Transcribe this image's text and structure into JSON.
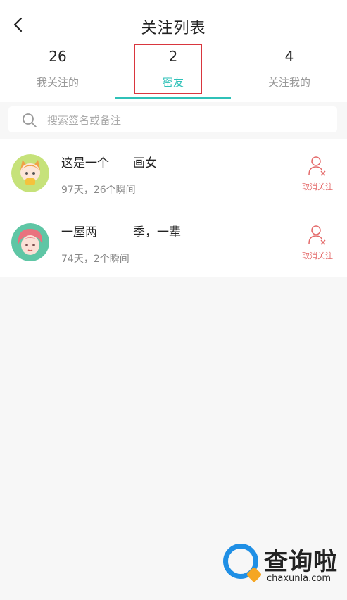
{
  "header": {
    "title": "关注列表"
  },
  "tabs": [
    {
      "count": "26",
      "label": "我关注的"
    },
    {
      "count": "2",
      "label": "密友"
    },
    {
      "count": "4",
      "label": "关注我的"
    }
  ],
  "search": {
    "placeholder": "搜索签名或备注"
  },
  "friends": [
    {
      "name": "这是一个　　画女",
      "meta": "97天，26个瞬间",
      "action": "取消关注"
    },
    {
      "name": "一屋两　　　季，一辈",
      "meta": "74天，2个瞬间",
      "action": "取消关注"
    }
  ],
  "watermark": {
    "brand": "查询啦",
    "domain": "chaxunla.com"
  },
  "colors": {
    "accent": "#2fc1b8",
    "highlight": "#d9363e",
    "unfollow": "#e46a6a"
  }
}
